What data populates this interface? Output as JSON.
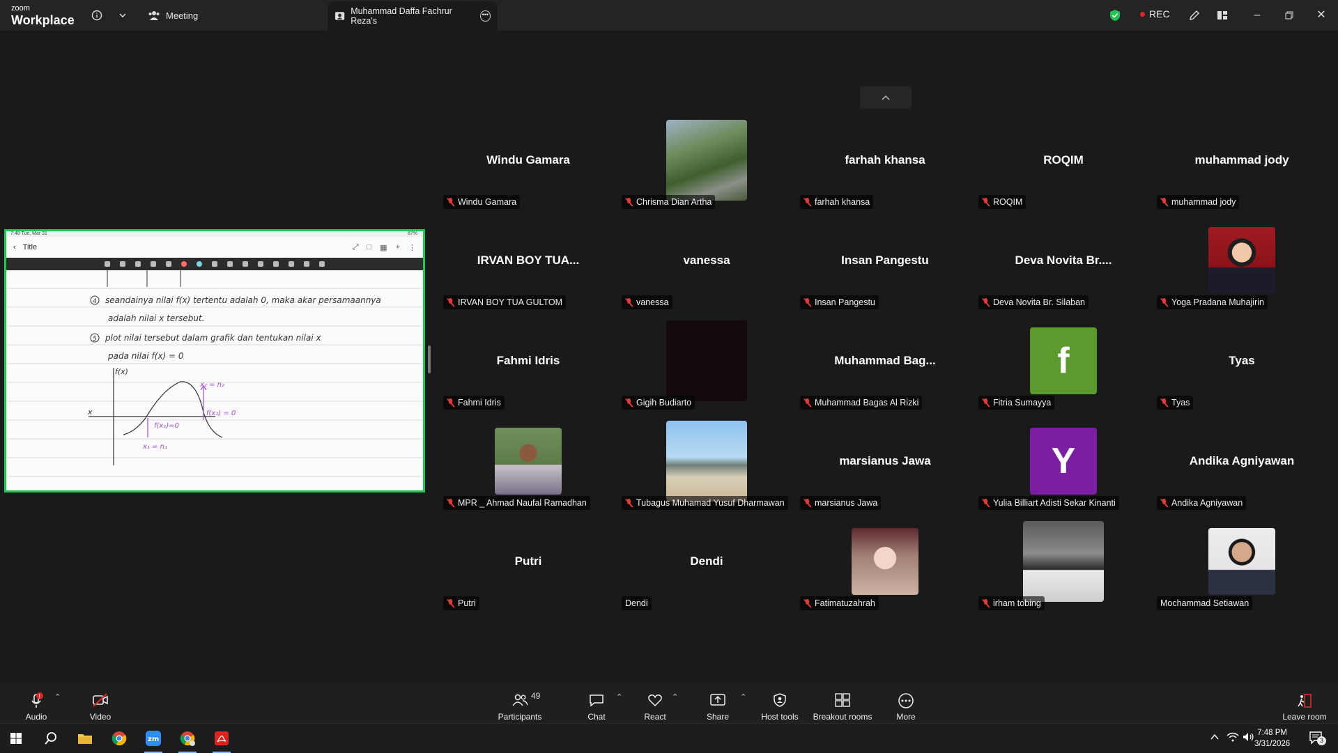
{
  "titlebar": {
    "logo_top": "zoom",
    "logo_bottom": "Workplace",
    "meeting_tab": "Meeting",
    "active_tab": "Muhammad Daffa Fachrur Reza's",
    "rec_label": "REC"
  },
  "share": {
    "status_left": "7:48  Tue, Mar 31",
    "status_right": "87%",
    "doc_title": "Title",
    "line1_num": "4",
    "line1": "seandainya nilai f(x) tertentu adalah 0, maka akar persamaannya",
    "line2": "adalah nilai x tersebut.",
    "line3_num": "5",
    "line3": "plot nilai tersebut dalam grafik dan tentukan nilai x",
    "line4": "pada nilai f(x) = 0",
    "axis_y": "f(x)",
    "axis_x": "x",
    "ann1": "f(x₁)=0",
    "ann2": "x₁ = n₁",
    "ann3": "x₂ = n₂",
    "ann4": "f(x₂) = 0"
  },
  "gallery": {
    "tiles": [
      {
        "big": "Windu Gamara",
        "label": "Windu Gamara",
        "muted": true
      },
      {
        "big": "",
        "label": "Chrisma Dian Artha",
        "muted": true,
        "photo": "aerial"
      },
      {
        "big": "farhah khansa",
        "label": "farhah khansa",
        "muted": true
      },
      {
        "big": "ROQIM",
        "label": "ROQIM",
        "muted": true
      },
      {
        "big": "muhammad jody",
        "label": "muhammad jody",
        "muted": true
      },
      {
        "big": "IRVAN BOY TUA...",
        "label": "IRVAN BOY TUA GULTOM",
        "muted": true
      },
      {
        "big": "vanessa",
        "label": "vanessa",
        "muted": true
      },
      {
        "big": "Insan Pangestu",
        "label": "Insan Pangestu",
        "muted": true
      },
      {
        "big": "Deva Novita Br....",
        "label": "Deva Novita Br. Silaban",
        "muted": true
      },
      {
        "big": "",
        "label": "Yoga Pradana Muhajirin",
        "muted": true,
        "photo": "portrait-red"
      },
      {
        "big": "Fahmi Idris",
        "label": "Fahmi Idris",
        "muted": true
      },
      {
        "big": "",
        "label": "Gigih Budiarto",
        "muted": true,
        "photo": "dark"
      },
      {
        "big": "Muhammad  Bag...",
        "label": "Muhammad Bagas Al Rizki",
        "muted": true
      },
      {
        "big": "",
        "label": "Fitria Sumayya",
        "muted": true,
        "letter": "f",
        "letter_color": "#5b9a2e"
      },
      {
        "big": "Tyas",
        "label": "Tyas",
        "muted": true
      },
      {
        "big": "",
        "label": "MPR _ Ahmad Naufal Ramadhan",
        "muted": true,
        "photo": "portrait-green"
      },
      {
        "big": "",
        "label": "Tubagus Muhamad Yusuf Dharmawan",
        "muted": true,
        "photo": "beach"
      },
      {
        "big": "marsianus Jawa",
        "label": "marsianus Jawa",
        "muted": true
      },
      {
        "big": "",
        "label": "Yulia Billiart Adisti Sekar Kinanti",
        "muted": true,
        "letter": "Y",
        "letter_color": "#7b1fa2"
      },
      {
        "big": "Andika Agniyawan",
        "label": "Andika Agniyawan",
        "muted": true
      },
      {
        "big": "Putri",
        "label": "Putri",
        "muted": true
      },
      {
        "big": "Dendi",
        "label": "Dendi",
        "muted": false
      },
      {
        "big": "",
        "label": "Fatimatuzahrah",
        "muted": true,
        "photo": "portrait-warm"
      },
      {
        "big": "",
        "label": "irham tobing",
        "muted": true,
        "photo": "street"
      },
      {
        "big": "",
        "label": "Mochammad Setiawan",
        "muted": false,
        "photo": "portrait-white"
      }
    ]
  },
  "toolbar": {
    "audio": "Audio",
    "video": "Video",
    "participants": "Participants",
    "participants_count": "49",
    "chat": "Chat",
    "react": "React",
    "share": "Share",
    "host_tools": "Host tools",
    "breakout": "Breakout rooms",
    "more": "More",
    "leave": "Leave room"
  },
  "taskbar": {
    "time": "7:48 PM",
    "date": "3/31/2026",
    "notif_count": "3"
  },
  "colors": {
    "share_border": "#23c552",
    "rec_dot": "#e02828",
    "muted_mic": "#e03a3a",
    "ink_purple": "#a14bd6"
  }
}
